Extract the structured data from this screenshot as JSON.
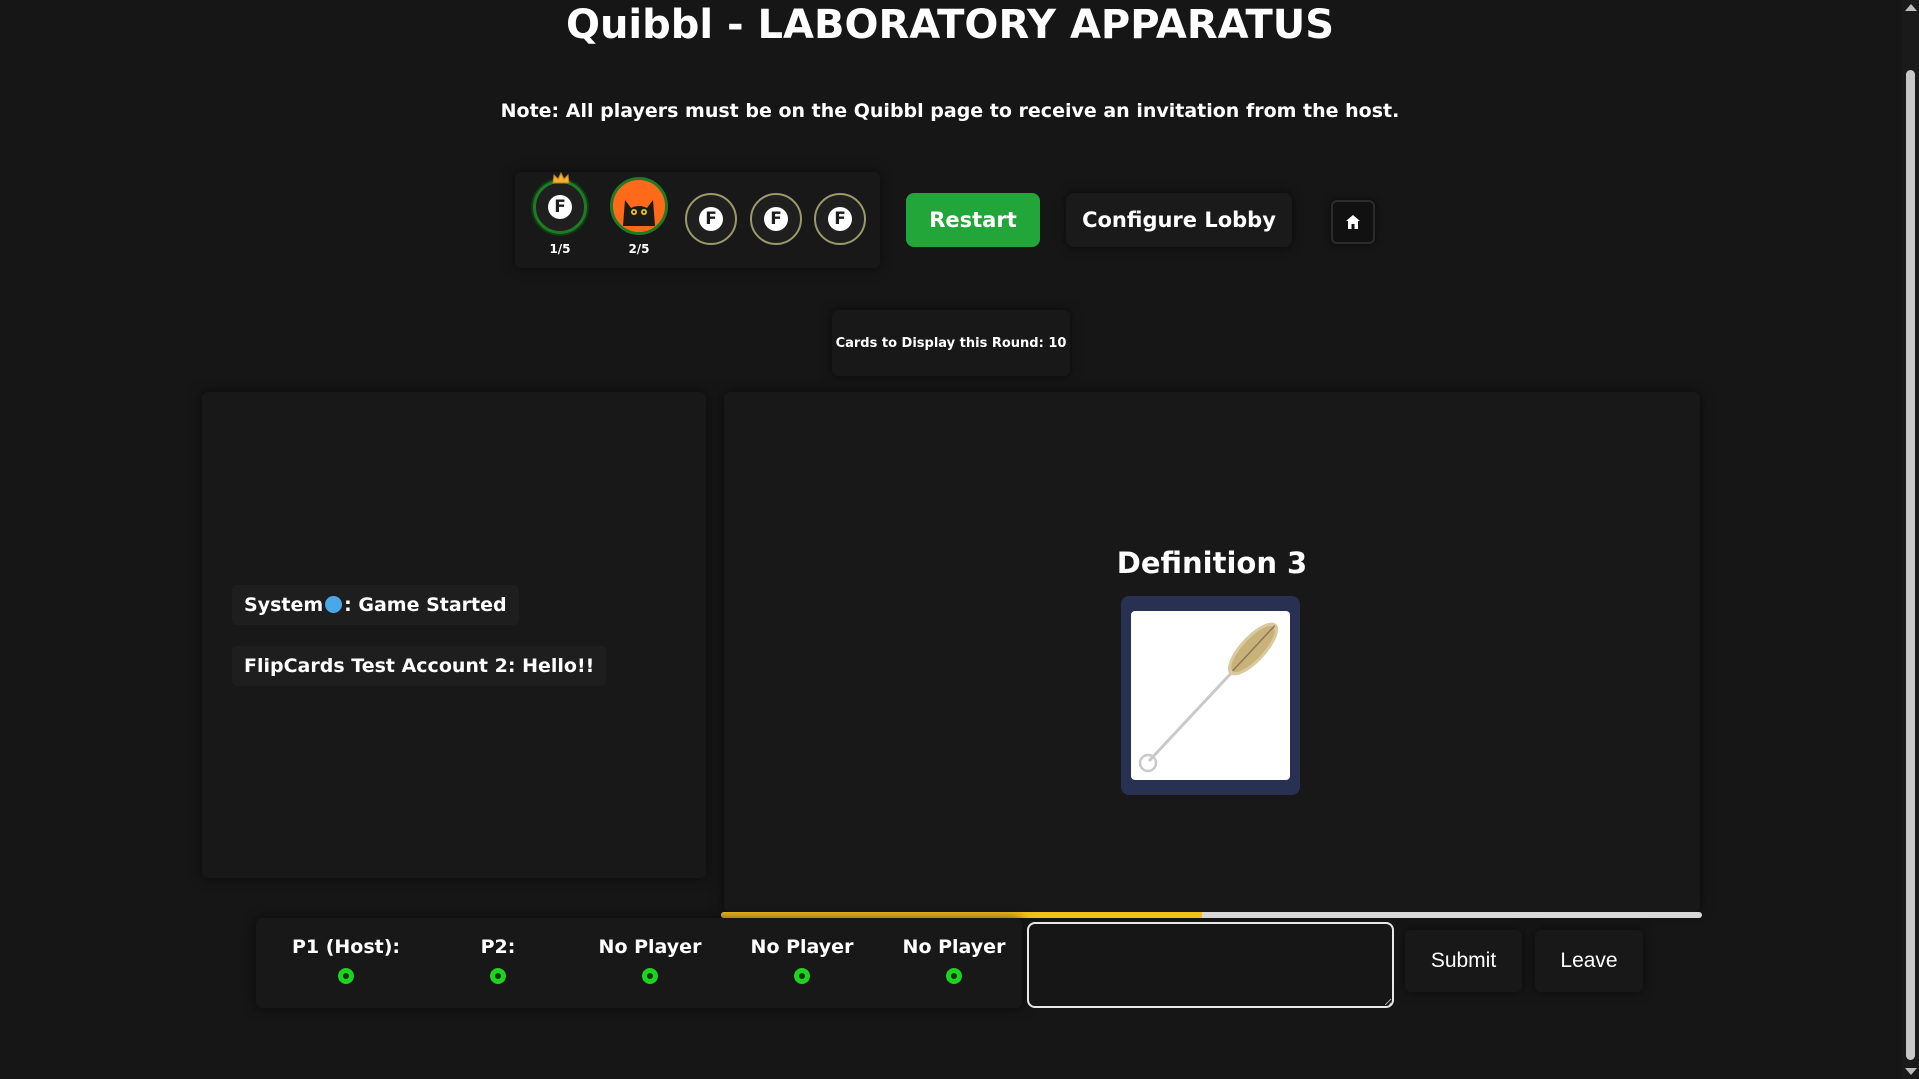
{
  "page": {
    "title": "Quibbl - LABORATORY APPARATUS",
    "note": "Note: All players must be on the Quibbl page to receive an invitation from the host."
  },
  "lobby": {
    "slots": [
      {
        "type": "host",
        "label": "1/5",
        "icon": "crown-icon"
      },
      {
        "type": "cat",
        "label": "2/5"
      },
      {
        "type": "empty",
        "label": ""
      },
      {
        "type": "empty",
        "label": ""
      },
      {
        "type": "empty",
        "label": ""
      }
    ],
    "avatar_letter": "F",
    "restart_label": "Restart",
    "configure_label": "Configure Lobby",
    "home_icon": "home-icon"
  },
  "round": {
    "cards_info": "Cards to Display this Round: 10"
  },
  "chat": {
    "messages": [
      {
        "sender": "System",
        "text": ": Game Started"
      },
      {
        "sender": "FlipCards Test Account 2",
        "text": ": Hello!!"
      }
    ]
  },
  "game": {
    "definition_title": "Definition 3",
    "card_image": "test-tube-brush",
    "timer_progress": 0.49
  },
  "scores": {
    "players": [
      {
        "name": "P1 (Host):"
      },
      {
        "name": "P2:"
      },
      {
        "name": "No Player"
      },
      {
        "name": "No Player"
      },
      {
        "name": "No Player"
      }
    ]
  },
  "actions": {
    "answer_value": "",
    "submit_label": "Submit",
    "leave_label": "Leave"
  },
  "colors": {
    "background": "#161616",
    "restart_green": "#22a63a",
    "progress_yellow": "#f2c21b",
    "card_navy": "#283152",
    "status_green": "#1fd21f"
  }
}
